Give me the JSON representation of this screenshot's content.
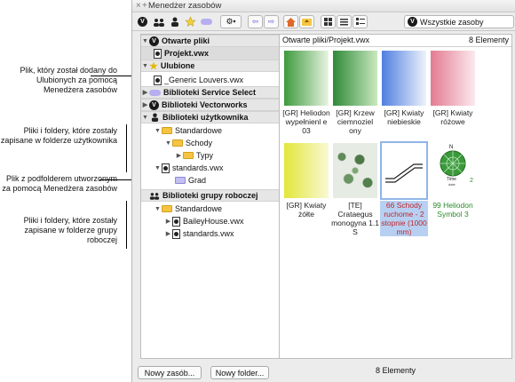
{
  "window": {
    "title": "Menedżer zasobów",
    "close_glyph": "×",
    "add_glyph": "+"
  },
  "toolbar": {
    "icons": [
      "vectorworks-icon",
      "workgroup-icon",
      "user-icon",
      "favorites-icon",
      "cloud-icon",
      "gear-icon",
      "back-icon",
      "forward-icon",
      "home-icon",
      "folder-up-icon",
      "grid-view-icon",
      "list-view-icon",
      "detail-view-icon"
    ],
    "gear_glyph": "⚙",
    "back_glyph": "⇦",
    "forward_glyph": "⇨",
    "filter_badge": "V",
    "filter": "Wszystkie zasoby"
  },
  "callouts": [
    {
      "text": "Plik, który został dodany do Ulubionych za pomocą Menedżera zasobów"
    },
    {
      "text": "Pliki i foldery, które zostały zapisane w folderze użytkownika"
    },
    {
      "text": "Plik z podfolderem utworzonym za pomocą Menedżera zasobów"
    },
    {
      "text": "Pliki i foldery, które zostały zapisane w folderze grupy roboczej"
    }
  ],
  "tree": {
    "open_files": "Otwarte pliki",
    "project_file": "Projekt.vwx",
    "favorites": "Ulubione",
    "favorite_file": "_Generic Louvers.vwx",
    "service_select": "Biblioteki Service Select",
    "vectorworks": "Biblioteki Vectorworks",
    "user_libs": "Biblioteki użytkownika",
    "user_standard": "Standardowe",
    "user_schody": "Schody",
    "user_typy": "Typy",
    "user_standards_file": "standards.vwx",
    "user_grad": "Grad",
    "workgroup_libs": "Biblioteki grupy roboczej",
    "wg_standard": "Standardowe",
    "wg_bailey": "BaileyHouse.vwx",
    "wg_standards_file": "standards.vwx"
  },
  "content": {
    "path": "Otwarte pliki/Projekt.vwx",
    "count": "8 Elementy",
    "tiles": [
      {
        "label": "[GR] Heliodon wypełnienl e 03"
      },
      {
        "label": "[GR] Krzew ciemnoziel ony"
      },
      {
        "label": "[GR] Kwiaty niebieskie"
      },
      {
        "label": "[GR] Kwiaty różowe"
      },
      {
        "label": "[GR] Kwiaty żółte"
      },
      {
        "label": "[TE] Crataegus monogyna 1.1 S"
      },
      {
        "label": "66 Schody ruchome - 2 stopnie (1000 mm)"
      },
      {
        "label": "99 Heliodon Symbol 3"
      }
    ],
    "heliodon_n": "N",
    "heliodon_time": "Time",
    "heliodon_date": "date",
    "heliodon_2": "2"
  },
  "buttons": {
    "new_resource": "Nowy zasób...",
    "new_folder": "Nowy folder..."
  },
  "footer": "8 Elementy",
  "colors": {
    "accent": "#b7d0f2",
    "selected_text": "#c0272d",
    "green_text": "#2b8a2b"
  }
}
